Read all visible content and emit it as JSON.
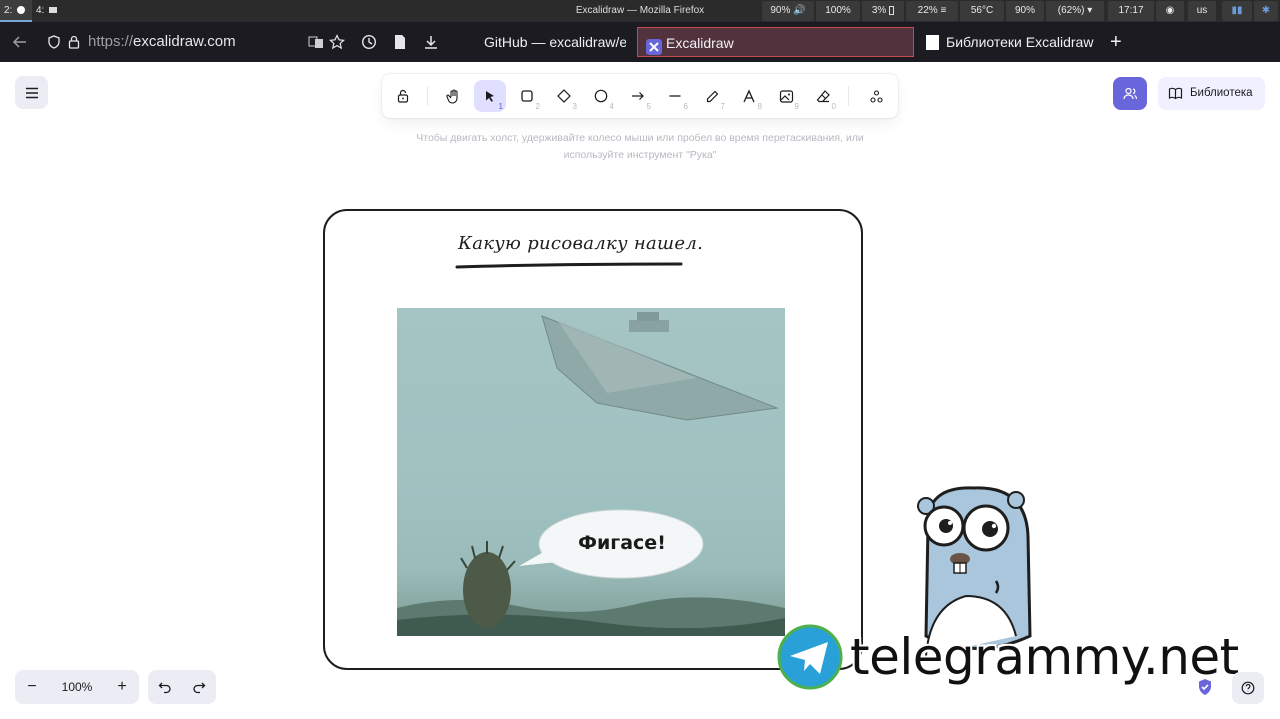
{
  "statusbar": {
    "workspaces": [
      "2:",
      "4:"
    ],
    "window_title": "Excalidraw — Mozilla Firefox",
    "items": [
      "90%",
      "100%",
      "3%",
      "22%",
      "56°C",
      "90%",
      "(62%)",
      "17:17",
      "us"
    ],
    "volume_icon": "speaker-icon",
    "battery_icon": "battery-icon",
    "cpu_icon": "menu-lines-icon",
    "wifi_icon": "wifi-icon"
  },
  "firefox": {
    "url_protocol": "https://",
    "url_host": "excalidraw.com",
    "tabs": [
      {
        "label": "GitHub — excalidraw/ex"
      },
      {
        "label": "Excalidraw"
      },
      {
        "label": "Библиотеки Excalidraw"
      }
    ],
    "new_tab": "+"
  },
  "toolbar": {
    "tools": [
      {
        "name": "lock",
        "key": ""
      },
      {
        "name": "hand",
        "key": ""
      },
      {
        "name": "selection",
        "key": "1"
      },
      {
        "name": "rectangle",
        "key": "2"
      },
      {
        "name": "diamond",
        "key": "3"
      },
      {
        "name": "ellipse",
        "key": "4"
      },
      {
        "name": "arrow",
        "key": "5"
      },
      {
        "name": "line",
        "key": "6"
      },
      {
        "name": "pencil",
        "key": "7"
      },
      {
        "name": "text",
        "key": "8"
      },
      {
        "name": "image",
        "key": "9"
      },
      {
        "name": "eraser",
        "key": "0"
      },
      {
        "name": "more-shapes",
        "key": ""
      }
    ],
    "active_tool": "selection",
    "accent": "#6965db"
  },
  "hint": {
    "line1": "Чтобы двигать холст, удерживайте колесо мыши или пробел во время перетаскивания, или",
    "line2": "используйте инструмент \"Рука\""
  },
  "library_button": {
    "label": "Библиотека"
  },
  "canvas": {
    "heading": "Какую рисовалку нашел.",
    "speech_bubble": "Фигасе!",
    "watermark": "telegrammy.net"
  },
  "zoom": {
    "level": "100%",
    "minus": "−",
    "plus": "+"
  },
  "colors": {
    "accent": "#6965db",
    "island_bg": "#ececf4",
    "active_tool_bg": "#e0dfff"
  }
}
